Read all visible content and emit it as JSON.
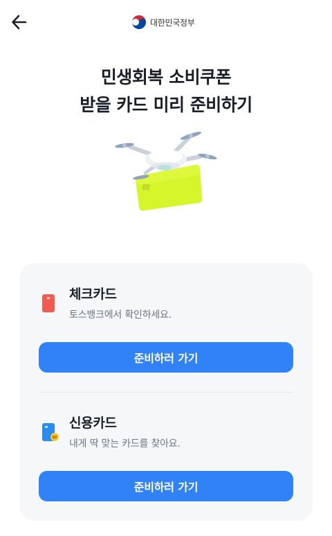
{
  "header": {
    "back_icon": "arrow-left-icon",
    "logo_text": "대한민국정부"
  },
  "title": {
    "line1": "민생회복 소비쿠폰",
    "line2": "받을 카드 미리 준비하기"
  },
  "options": [
    {
      "name": "체크카드",
      "desc": "토스뱅크에서 확인하세요.",
      "button": "준비하러 가기",
      "icon": "check-card-icon"
    },
    {
      "name": "신용카드",
      "desc": "내게 딱 맞는 카드를 찾아요.",
      "button": "준비하러 가기",
      "icon": "credit-card-icon"
    }
  ],
  "colors": {
    "primary": "#3182f6",
    "panel_bg": "#f6f7f9",
    "title": "#191f28",
    "subtext": "#6b7684"
  }
}
